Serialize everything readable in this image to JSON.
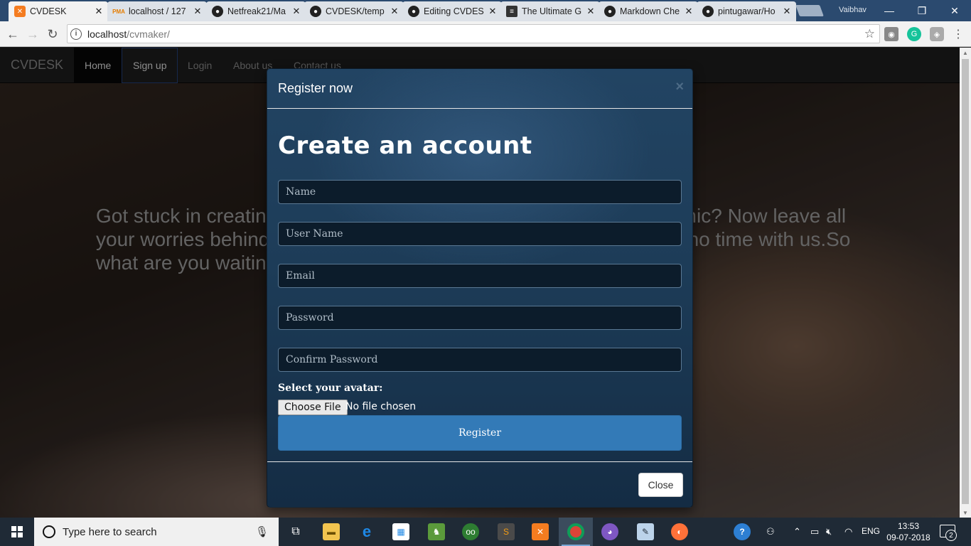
{
  "browser": {
    "tabs": [
      {
        "label": "CVDESK",
        "icon": "xampp-icon",
        "active": true
      },
      {
        "label": "localhost / 127",
        "icon": "phpmyadmin-icon"
      },
      {
        "label": "Netfreak21/Ma",
        "icon": "github-icon"
      },
      {
        "label": "CVDESK/temp",
        "icon": "github-icon"
      },
      {
        "label": "Editing CVDES",
        "icon": "github-icon"
      },
      {
        "label": "The Ultimate G",
        "icon": "document-icon"
      },
      {
        "label": "Markdown Che",
        "icon": "github-icon"
      },
      {
        "label": "pintugawar/Ho",
        "icon": "github-icon"
      }
    ],
    "profile_name": "Vaibhav",
    "url_host": "localhost",
    "url_path": "/cvmaker/"
  },
  "site": {
    "brand": "CVDESK",
    "nav": [
      "Home",
      "Sign up",
      "Login",
      "About us",
      "Contact us"
    ],
    "hero_text": "Got stuck in creating your resume for work, job, interview or academic? Now leave all your worries behind as CVDESK will help you build your resume in no time with us.So what are you waiting for?"
  },
  "modal": {
    "title": "Register now",
    "heading": "Create an account",
    "fields": {
      "name_placeholder": "Name",
      "username_placeholder": "User Name",
      "email_placeholder": "Email",
      "password_placeholder": "Password",
      "confirm_placeholder": "Confirm Password"
    },
    "avatar_label": "Select your avatar:",
    "file_button": "Choose File",
    "file_status": "No file chosen",
    "register_label": "Register",
    "close_label": "Close"
  },
  "taskbar": {
    "search_placeholder": "Type here to search",
    "language": "ENG",
    "time": "13:53",
    "date": "09-07-2018",
    "notification_count": "2"
  },
  "colors": {
    "primary_button": "#337ab7",
    "navbar": "#222222",
    "modal_bg": "#1d3c58"
  }
}
